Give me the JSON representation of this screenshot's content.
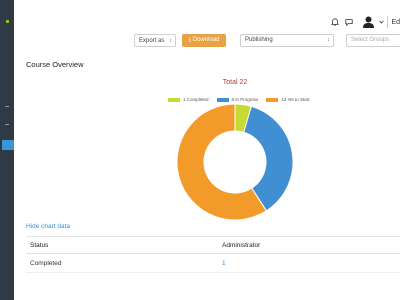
{
  "topbar": {
    "user_fragment": "Ed"
  },
  "toolbar": {
    "export_label": "Export as",
    "download_label": "Download",
    "publishing_value": "Publishing",
    "groups_placeholder": "Select Groups"
  },
  "main": {
    "title": "Course Overview",
    "hide_chart_label": "Hide chart data"
  },
  "chart_data": {
    "type": "pie",
    "title": "Total 22",
    "categories": [
      "1 Completed",
      "8 In Progress",
      "13 Yet to Start"
    ],
    "values": [
      1,
      8,
      13
    ],
    "colors": [
      "#c7d933",
      "#3f8fd2",
      "#f39b2a"
    ],
    "legend_position": "top",
    "donut": true
  },
  "table": {
    "headers": [
      "Status",
      "Administrator"
    ],
    "rows": [
      [
        "Completed",
        "1"
      ]
    ]
  }
}
